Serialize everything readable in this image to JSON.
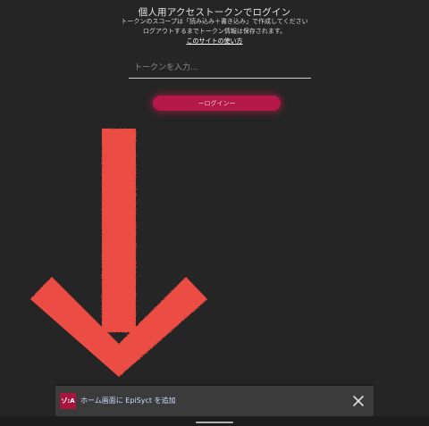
{
  "login": {
    "title": "個人用アクセストークンでログイン",
    "description_line1": "トークンのスコープは「読み込み＋書き込み」で作成してください",
    "description_line2": "ログアウトするまでトークン情報は保存されます。",
    "help_link": "このサイトの使い方",
    "token_placeholder": "トークンを入力...",
    "token_value": "",
    "login_button": "ーログインー"
  },
  "annotation": {
    "icon": "down-arrow-icon",
    "color": "#e8443d"
  },
  "banner": {
    "app_icon_text": "ゾ:A",
    "text": "ホーム画面に EpiSyct を追加",
    "close_icon": "close-icon",
    "icon_color": "#a8163f",
    "text_color": "#c9dcff"
  },
  "colors": {
    "background": "#252525",
    "accent": "#b4174a"
  }
}
